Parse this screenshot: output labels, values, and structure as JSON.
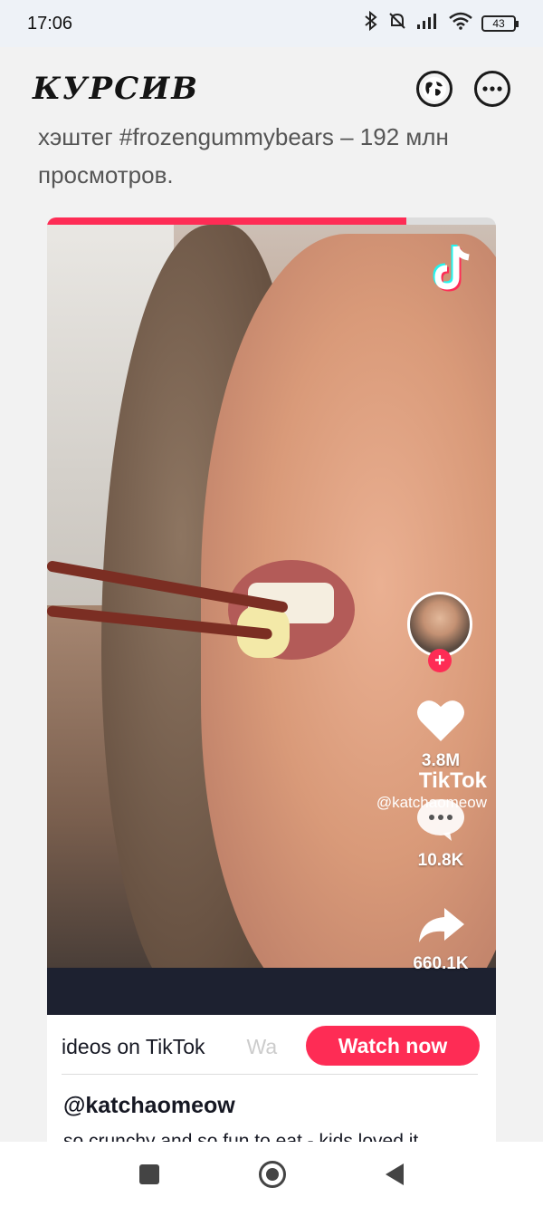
{
  "status_bar": {
    "time": "17:06",
    "battery": "43"
  },
  "app_bar": {
    "logo": "КУРСИВ"
  },
  "article": {
    "text_line1": "хэштег #frozengummybears – 192 млн",
    "text_line2": "просмотров."
  },
  "tiktok_embed": {
    "progress": 0.8,
    "like_count": "3.8M",
    "comment_count": "10.8K",
    "share_count": "660.1K",
    "watermark_name": "TikTok",
    "watermark_user": "@katchaomeow",
    "banner_text": "ideos on TikTok",
    "banner_text_next": "Wa",
    "watch_button": "Watch now",
    "username": "@katchaomeow",
    "caption": "so crunchy and so fun to eat - kids loved it"
  }
}
